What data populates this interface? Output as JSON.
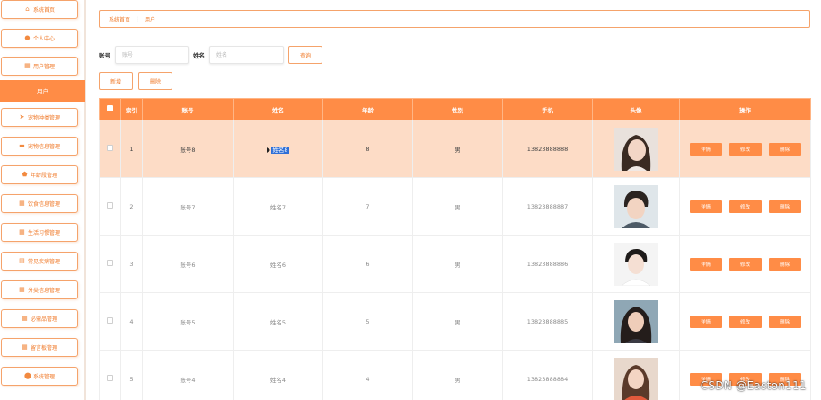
{
  "sidebar": {
    "items": [
      {
        "label": "系统首页",
        "icon": "home-icon",
        "glyph": "⌂"
      },
      {
        "label": "个人中心",
        "icon": "user-icon",
        "glyph": "●"
      },
      {
        "label": "用户管理",
        "icon": "grid-icon",
        "glyph": "▦"
      },
      {
        "label": "用户",
        "icon": "",
        "glyph": ""
      },
      {
        "label": "宠物种类管理",
        "icon": "send-icon",
        "glyph": "➤"
      },
      {
        "label": "宠物信息管理",
        "icon": "monitor-icon",
        "glyph": "▬"
      },
      {
        "label": "年龄段管理",
        "icon": "shield-icon",
        "glyph": "⬟"
      },
      {
        "label": "饮食信息管理",
        "icon": "grid-icon",
        "glyph": "▦"
      },
      {
        "label": "生活习惯管理",
        "icon": "grid-icon",
        "glyph": "▦"
      },
      {
        "label": "常见疾病管理",
        "icon": "briefcase-icon",
        "glyph": "▤"
      },
      {
        "label": "分类信息管理",
        "icon": "grid-icon",
        "glyph": "▦"
      },
      {
        "label": "必需品管理",
        "icon": "grid-icon",
        "glyph": "▦"
      },
      {
        "label": "留言板管理",
        "icon": "grid-icon",
        "glyph": "▦"
      },
      {
        "label": "系统管理",
        "icon": "location-icon",
        "glyph": "⬤"
      }
    ]
  },
  "breadcrumb": {
    "home": "系统首页",
    "sep": "⋮",
    "current": "用户"
  },
  "search": {
    "account_label": "账号",
    "account_placeholder": "账号",
    "name_label": "姓名",
    "name_placeholder": "姓名",
    "query_button": "查询"
  },
  "actions": {
    "add": "新增",
    "delete": "删除"
  },
  "table": {
    "headers": [
      "",
      "索引",
      "账号",
      "姓名",
      "年龄",
      "性别",
      "手机",
      "头像",
      "操作"
    ],
    "rows": [
      {
        "index": "1",
        "account": "账号8",
        "name": "姓名8",
        "age": "8",
        "gender": "男",
        "phone": "13823888888"
      },
      {
        "index": "2",
        "account": "账号7",
        "name": "姓名7",
        "age": "7",
        "gender": "男",
        "phone": "13823888887"
      },
      {
        "index": "3",
        "account": "账号6",
        "name": "姓名6",
        "age": "6",
        "gender": "男",
        "phone": "13823888886"
      },
      {
        "index": "4",
        "account": "账号5",
        "name": "姓名5",
        "age": "5",
        "gender": "男",
        "phone": "13823888885"
      },
      {
        "index": "5",
        "account": "账号4",
        "name": "姓名4",
        "age": "4",
        "gender": "男",
        "phone": "13823888884"
      }
    ],
    "ops": {
      "detail": "详情",
      "edit": "修改",
      "delete": "删除"
    }
  },
  "watermark": "CSDN @Easton111",
  "colors": {
    "accent": "#ff8c46",
    "highlight_row": "#fddcc6",
    "selection": "#2f6fd6"
  }
}
